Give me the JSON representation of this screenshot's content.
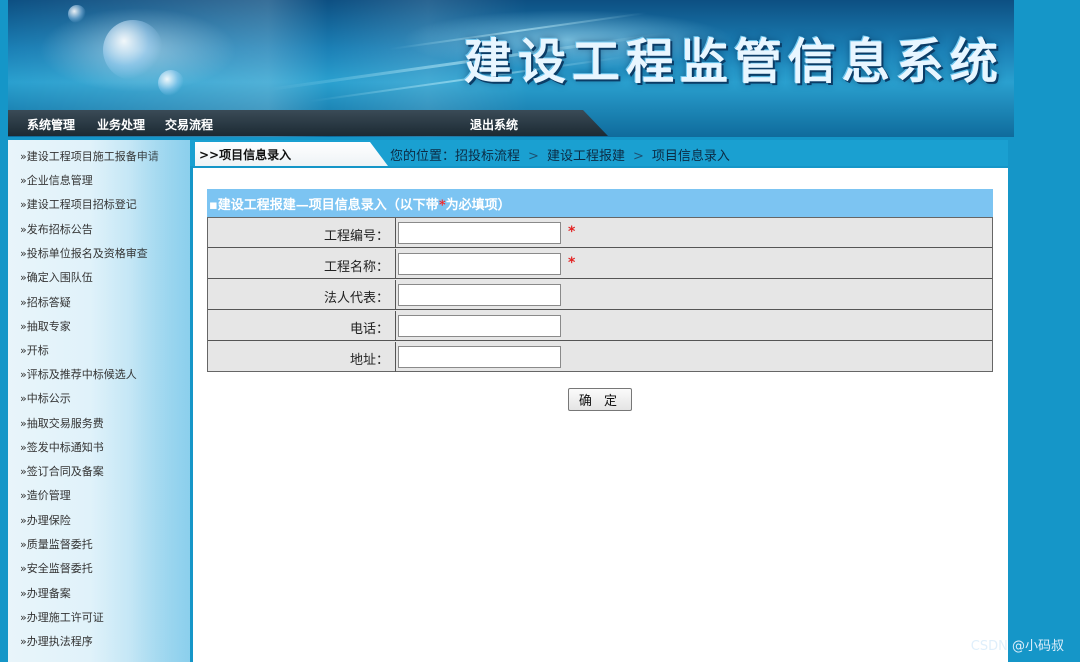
{
  "header": {
    "system_title": "建设工程监管信息系统"
  },
  "top_menu": {
    "items": [
      "系统管理",
      "业务处理",
      "交易流程"
    ],
    "logout": "退出系统"
  },
  "sidebar": {
    "items": [
      {
        "label": "»建设工程项目施工报备申请"
      },
      {
        "label": "»企业信息管理"
      },
      {
        "label": "»建设工程项目招标登记"
      },
      {
        "label": "»发布招标公告"
      },
      {
        "label": "»投标单位报名及资格审查"
      },
      {
        "label": "»确定入围队伍"
      },
      {
        "label": "»招标答疑"
      },
      {
        "label": "»抽取专家"
      },
      {
        "label": "»开标"
      },
      {
        "label": "»评标及推荐中标候选人"
      },
      {
        "label": "»中标公示"
      },
      {
        "label": "»抽取交易服务费"
      },
      {
        "label": "»签发中标通知书"
      },
      {
        "label": "»签订合同及备案"
      },
      {
        "label": "»造价管理"
      },
      {
        "label": "»办理保险"
      },
      {
        "label": "»质量监督委托"
      },
      {
        "label": "»安全监督委托"
      },
      {
        "label": "»办理备案"
      },
      {
        "label": "»办理施工许可证"
      },
      {
        "label": "»办理执法程序"
      }
    ]
  },
  "tab": {
    "label": ">>项目信息录入"
  },
  "breadcrumb": {
    "prefix": "您的位置：",
    "items": [
      "招投标流程",
      "建设工程报建",
      "项目信息录入"
    ],
    "separator": ">"
  },
  "form": {
    "title_prefix": "▪建设工程报建—项目信息录入（以下带",
    "title_star": "*",
    "title_suffix": "为必填项）",
    "fields": [
      {
        "label": "工程编号：",
        "value": "",
        "required": true
      },
      {
        "label": "工程名称：",
        "value": "",
        "required": true
      },
      {
        "label": "法人代表：",
        "value": "",
        "required": false
      },
      {
        "label": "电话：",
        "value": "",
        "required": false
      },
      {
        "label": "地址：",
        "value": "",
        "required": false
      }
    ],
    "required_mark": "*",
    "submit_label": "确 定"
  },
  "watermark": "CSDN @小码叔",
  "colors": {
    "page_bg": "#1596c8",
    "form_title_bg": "#7cc4f2",
    "required": "#e32222"
  }
}
